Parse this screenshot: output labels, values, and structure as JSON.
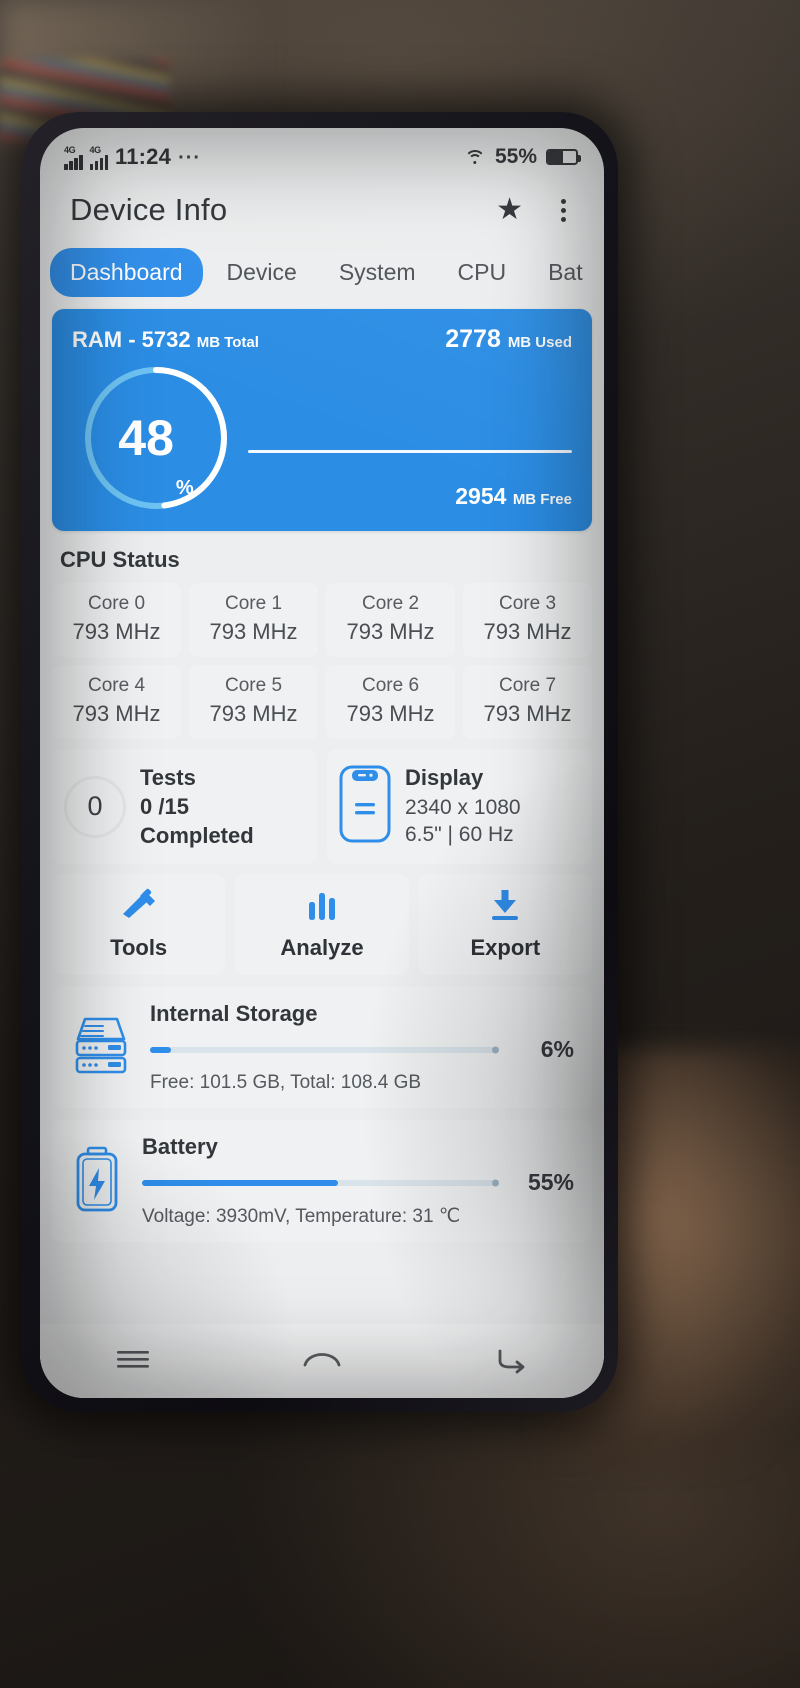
{
  "status_bar": {
    "network_badges": [
      "4G",
      "4G"
    ],
    "time": "11:24",
    "more_dots": "···",
    "wifi_icon": "wifi-icon",
    "battery_percent": "55%",
    "battery_icon": "battery-icon"
  },
  "app_bar": {
    "title": "Device Info",
    "star_icon": "★",
    "star_icon_name": "favorite-star-icon",
    "overflow_icon_name": "overflow-menu-icon"
  },
  "tabs": [
    {
      "label": "Dashboard",
      "active": true
    },
    {
      "label": "Device",
      "active": false
    },
    {
      "label": "System",
      "active": false
    },
    {
      "label": "CPU",
      "active": false
    },
    {
      "label": "Bat",
      "active": false
    }
  ],
  "ram_card": {
    "title_prefix": "RAM - 5732",
    "title_suffix": "MB Total",
    "used_value": "2778",
    "used_suffix": "MB Used",
    "percent": "48",
    "percent_symbol": "%",
    "free_value": "2954",
    "free_suffix": "MB Free",
    "accent_color": "#2b8de4",
    "percent_numeric": 48
  },
  "cpu_status": {
    "title": "CPU Status",
    "cores": [
      {
        "name": "Core 0",
        "freq": "793 MHz"
      },
      {
        "name": "Core 1",
        "freq": "793 MHz"
      },
      {
        "name": "Core 2",
        "freq": "793 MHz"
      },
      {
        "name": "Core 3",
        "freq": "793 MHz"
      },
      {
        "name": "Core 4",
        "freq": "793 MHz"
      },
      {
        "name": "Core 5",
        "freq": "793 MHz"
      },
      {
        "name": "Core 6",
        "freq": "793 MHz"
      },
      {
        "name": "Core 7",
        "freq": "793 MHz"
      }
    ]
  },
  "tests_card": {
    "count": "0",
    "label": "Tests",
    "ratio": "0 /15",
    "status": "Completed"
  },
  "display_card": {
    "icon_name": "phone-display-icon",
    "title": "Display",
    "resolution": "2340 x 1080",
    "specs": "6.5\" | 60 Hz"
  },
  "actions": [
    {
      "label": "Tools",
      "icon_name": "tools-icon"
    },
    {
      "label": "Analyze",
      "icon_name": "analyze-bars-icon"
    },
    {
      "label": "Export",
      "icon_name": "export-download-icon"
    }
  ],
  "internal_storage": {
    "icon_name": "storage-drive-icon",
    "title": "Internal Storage",
    "percent_label": "6%",
    "percent_numeric": 6,
    "detail": "Free: 101.5 GB,  Total: 108.4 GB"
  },
  "battery_card": {
    "icon_name": "battery-bolt-icon",
    "title": "Battery",
    "percent_label": "55%",
    "percent_numeric": 55,
    "detail": "Voltage: 3930mV,  Temperature: 31 ℃"
  },
  "nav_bar": {
    "recents_icon_name": "recents-menu-icon",
    "home_icon_name": "home-icon",
    "back_icon_name": "back-icon"
  }
}
